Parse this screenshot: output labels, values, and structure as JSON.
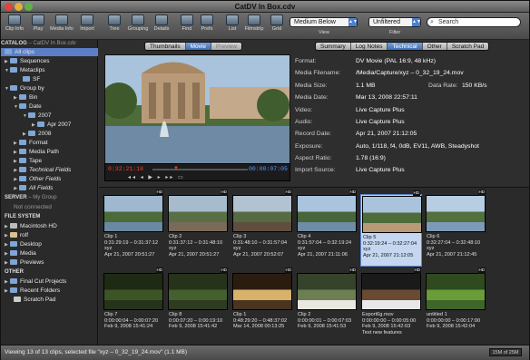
{
  "window": {
    "title": "CatDV In Box.cdv"
  },
  "toolbar": {
    "buttons": [
      "Clip Info",
      "Play",
      "Media Info",
      "Import",
      "Tree",
      "Grouping",
      "Details",
      "Find",
      "Prefs",
      "List",
      "Filmstrip",
      "Grid"
    ],
    "view_select": "Medium Below",
    "view_label": "View",
    "filter_select": "Unfiltered",
    "filter_label": "Filter",
    "search_placeholder": "Search"
  },
  "sidebar": {
    "catalog_header": "CATALOG",
    "catalog_name": "– CatDV In Box.cdv",
    "items": [
      {
        "label": "All clips"
      },
      {
        "label": "Sequences"
      },
      {
        "label": "Metaclips"
      },
      {
        "label": "SF"
      },
      {
        "label": "Group by"
      },
      {
        "label": "Bin"
      },
      {
        "label": "Date"
      },
      {
        "label": "2007"
      },
      {
        "label": "Apr 2007"
      },
      {
        "label": "2008"
      },
      {
        "label": "Format"
      },
      {
        "label": "Media Path"
      },
      {
        "label": "Tape"
      },
      {
        "label": "Technical Fields"
      },
      {
        "label": "Other Fields"
      },
      {
        "label": "All Fields"
      }
    ],
    "server_header": "SERVER",
    "server_name": "– My Group",
    "server_status": "Not connected",
    "fs_header": "FILE SYSTEM",
    "fs_items": [
      "Macintosh HD",
      "rolf",
      "Desktop",
      "Media",
      "Previews"
    ],
    "other_header": "OTHER",
    "other_items": [
      "Final Cut Projects",
      "Recent Folders",
      "Scratch Pad"
    ]
  },
  "tabs_left": [
    "Thumbnails",
    "Movie",
    "Preview"
  ],
  "tabs_right": [
    "Summary",
    "Log Notes",
    "Technical",
    "Other",
    "Scratch Pad"
  ],
  "player": {
    "timecode_in": "0:32:21:18",
    "timecode_out": "00:00:07:05"
  },
  "technical": {
    "format": {
      "k": "Format:",
      "v": "DV Movie (PAL 16:9, 48 kHz)"
    },
    "filename": {
      "k": "Media Filename:",
      "v": "/Media/Capture/xyz – 0_32_19_24.mov"
    },
    "size": {
      "k": "Media Size:",
      "v": "1.1 MB",
      "k2": "Data Rate:",
      "v2": "150 KB/s"
    },
    "date": {
      "k": "Media Date:",
      "v": "Mar 13, 2008 22:57:11"
    },
    "video": {
      "k": "Video:",
      "v": "Live Capture Plus"
    },
    "audio": {
      "k": "Audio:",
      "v": "Live Capture Plus"
    },
    "record": {
      "k": "Record Date:",
      "v": "Apr 21, 2007 21:12:05"
    },
    "exposure": {
      "k": "Exposure:",
      "v": "Auto, 1/118, f4, 0dB, EV11, AWB, Steadyshot"
    },
    "aspect": {
      "k": "Aspect Ratio:",
      "v": "1.78 (16:9)"
    },
    "import": {
      "k": "Import Source:",
      "v": "Live Capture Plus"
    }
  },
  "clips": [
    {
      "name": "Clip 1",
      "tc": "0:31:29:19 – 0:31:37:12",
      "sub": "xyz",
      "date": "Apr 21, 2007 20:51:27",
      "thumb": "scene-water"
    },
    {
      "name": "Clip 2",
      "tc": "0:31:37:12 – 0:31:48:10",
      "sub": "xyz",
      "date": "Apr 21, 2007 20:51:27",
      "thumb": "scene-people"
    },
    {
      "name": "Clip 3",
      "tc": "0:31:48:10 – 0:31:57:04",
      "sub": "xyz",
      "date": "Apr 21, 2007 20:52:07",
      "thumb": "scene-crowd"
    },
    {
      "name": "Clip 4",
      "tc": "0:31:57:04 – 0:32:19:24",
      "sub": "xyz",
      "date": "Apr 21, 2007 21:11:06",
      "thumb": "scene-pond"
    },
    {
      "name": "Clip 5",
      "tc": "0:32:19:24 – 0:32:27:04",
      "sub": "xyz",
      "date": "Apr 21, 2007 21:12:05",
      "thumb": "scene-palace"
    },
    {
      "name": "Clip 6",
      "tc": "0:32:27:04 – 0:32:48:10",
      "sub": "xyz",
      "date": "Apr 21, 2007 21:12:45",
      "thumb": "scene-lake"
    },
    {
      "name": "Clip 7",
      "tc": "0:00:00:04 – 0:00:07:20",
      "sub": "",
      "date": "Feb 9, 2008 15:41:24",
      "thumb": "scene-trees"
    },
    {
      "name": "Clip 8",
      "tc": "0:00:07:20 – 0:00:19:10",
      "sub": "",
      "date": "Feb 9, 2008 15:41:42",
      "thumb": "scene-trees2"
    },
    {
      "name": "Clip 1",
      "tc": "0:48:29:20 – 0:48:37:02",
      "sub": "",
      "date": "Mar 14, 2008 00:13:25",
      "thumb": "scene-light"
    },
    {
      "name": "Clip 2",
      "tc": "0:00:00:01 – 0:00:07:03",
      "sub": "",
      "date": "Feb 9, 2008 15:41:53",
      "thumb": "scene-bride"
    },
    {
      "name": "Export6g.mov",
      "tc": "0:00:00:00 – 0:00:05:00",
      "sub": "",
      "date": "Feb 9, 2008 15:42:03",
      "thumb": "scene-face",
      "note": "Test new features"
    },
    {
      "name": "untitled 1",
      "tc": "0:00:00:00 – 0:00:17:00",
      "sub": "",
      "date": "Feb 9, 2008 15:42:04",
      "thumb": "scene-green"
    }
  ],
  "status": {
    "text": "Viewing 13 of 13 clips, selected file \"xyz – 0_32_19_24.mov\" (1.1 MB)",
    "mem": "15M of 25M"
  }
}
